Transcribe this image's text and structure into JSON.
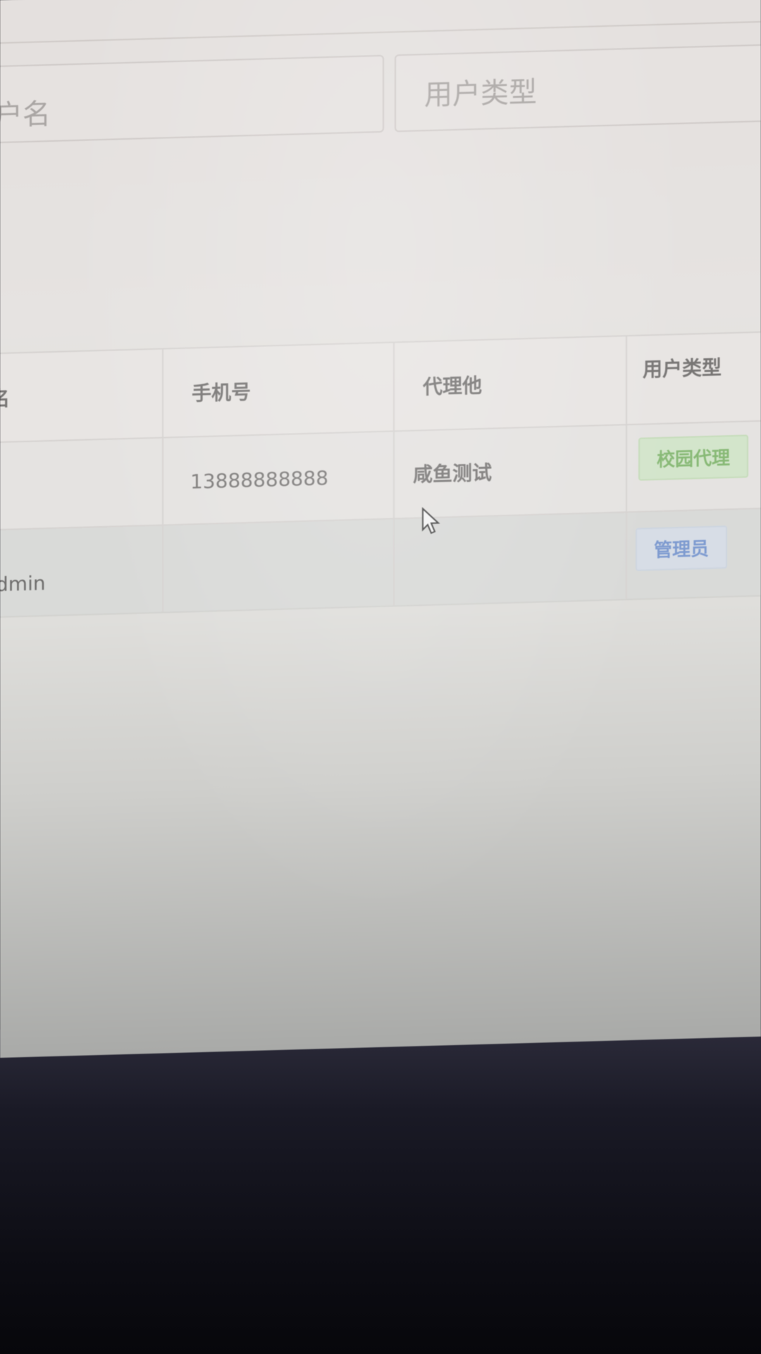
{
  "filters": {
    "username_placeholder": "用户名",
    "username_visible_fragment": "户名",
    "usertype_placeholder": "用户类型"
  },
  "table": {
    "columns": [
      "用户名",
      "手机号",
      "代理他",
      "用户类型"
    ],
    "columns_visible": [
      "名",
      "手机号",
      "代理他",
      "用户类型"
    ],
    "rows": [
      {
        "username": "",
        "phone": "13888888888",
        "agent": "咸鱼测试",
        "user_type": "校园代理",
        "user_type_color": "#88b976"
      },
      {
        "username_visible_fragment": "dmin",
        "phone": "",
        "agent": "",
        "user_type": "管理员",
        "user_type_color": "#7e9bd0"
      }
    ]
  },
  "icons": {
    "cursor": "mouse-pointer-icon"
  }
}
